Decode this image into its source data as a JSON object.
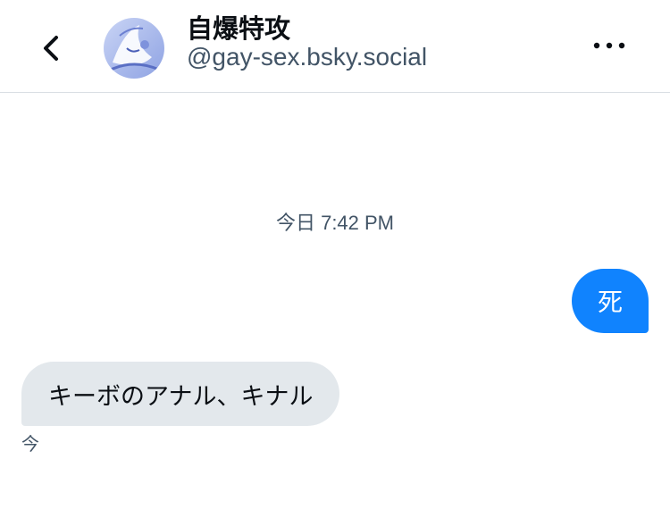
{
  "header": {
    "back_icon": "chevron-left-icon",
    "display_name": "自爆特攻",
    "handle": "@gay-sex.bsky.social",
    "avatar": "avatar-image",
    "more_icon": "more-horizontal-icon"
  },
  "conversation": {
    "timestamp": "今日 7:42 PM",
    "messages": [
      {
        "direction": "outgoing",
        "text": "死",
        "color": "#1083fe"
      },
      {
        "direction": "incoming",
        "text": "キーボのアナル、キナル",
        "meta": "今",
        "color": "#e3e8ec"
      }
    ]
  },
  "colors": {
    "accent": "#1083fe",
    "incoming_bubble": "#e3e8ec",
    "secondary_text": "#425466",
    "divider": "#d9dee4"
  }
}
